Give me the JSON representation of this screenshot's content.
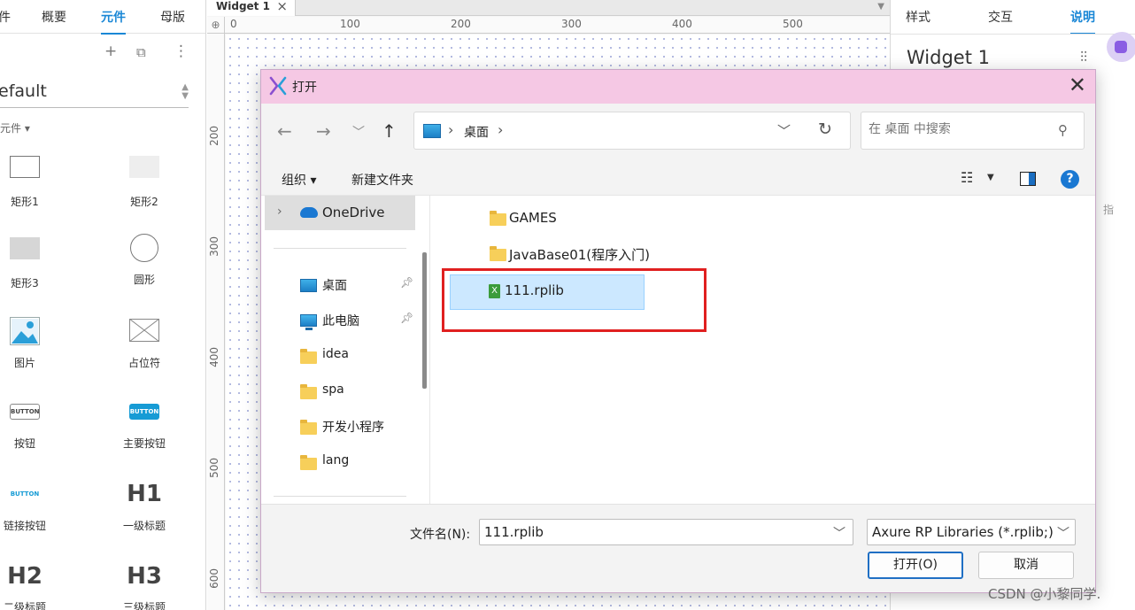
{
  "left_panel": {
    "tabs": [
      "件",
      "概要",
      "元件",
      "母版"
    ],
    "library_name": "efault",
    "library_sub": "本元件 ▾",
    "tools": {
      "add": "+",
      "copy": "⧉",
      "more": "⋮"
    },
    "widgets": [
      {
        "label": "矩形1"
      },
      {
        "label": "矩形2"
      },
      {
        "label": "矩形3"
      },
      {
        "label": "圆形"
      },
      {
        "label": "图片"
      },
      {
        "label": "占位符"
      },
      {
        "label": "按钮",
        "text": "BUTTON"
      },
      {
        "label": "主要按钮",
        "text": "BUTTON"
      },
      {
        "label": "链接按钮",
        "text": "BUTTON"
      },
      {
        "label": "一级标题",
        "text": "H1"
      },
      {
        "label": "二级标题",
        "text": "H2"
      },
      {
        "label": "三级标题",
        "text": "H3"
      }
    ]
  },
  "canvas": {
    "tab_label": "Widget 1",
    "h_ruler": [
      "0",
      "100",
      "200",
      "300",
      "400",
      "500"
    ],
    "v_ruler": [
      "200",
      "300",
      "400",
      "500",
      "600"
    ]
  },
  "right_panel": {
    "tabs": [
      "样式",
      "交互",
      "说明"
    ],
    "widget_title": "Widget 1",
    "side_char": "指"
  },
  "dialog": {
    "title": "打开",
    "address": {
      "crumb": "桌面",
      "sep": "›"
    },
    "search_placeholder": "在 桌面 中搜索",
    "toolbar": {
      "organize": "组织 ▾",
      "new_folder": "新建文件夹"
    },
    "nav": {
      "onedrive": "OneDrive",
      "items": [
        {
          "label": "桌面",
          "pinned": true,
          "icon": "desktop-icon"
        },
        {
          "label": "此电脑",
          "pinned": true,
          "icon": "computer-icon"
        },
        {
          "label": "idea",
          "icon": "folder-icon"
        },
        {
          "label": "spa",
          "icon": "folder-icon"
        },
        {
          "label": "开发小程序",
          "icon": "folder-icon"
        },
        {
          "label": "lang",
          "icon": "folder-icon"
        }
      ]
    },
    "files": [
      {
        "name": "GAMES",
        "type": "folder"
      },
      {
        "name": "JavaBase01(程序入门)",
        "type": "folder"
      },
      {
        "name": "111.rplib",
        "type": "rplib",
        "selected": true
      }
    ],
    "filename_label": "文件名(N):",
    "filename_value": "111.rplib",
    "filter": "Axure RP Libraries (*.rplib;)",
    "open_label": "打开(O)",
    "cancel_label": "取消"
  },
  "watermark": "CSDN @小黎同学.",
  "colors": {
    "accent": "#1a87d6",
    "dialog_titlebar": "#f5c8e4",
    "highlight": "#e02020",
    "selection": "#cce8ff"
  }
}
